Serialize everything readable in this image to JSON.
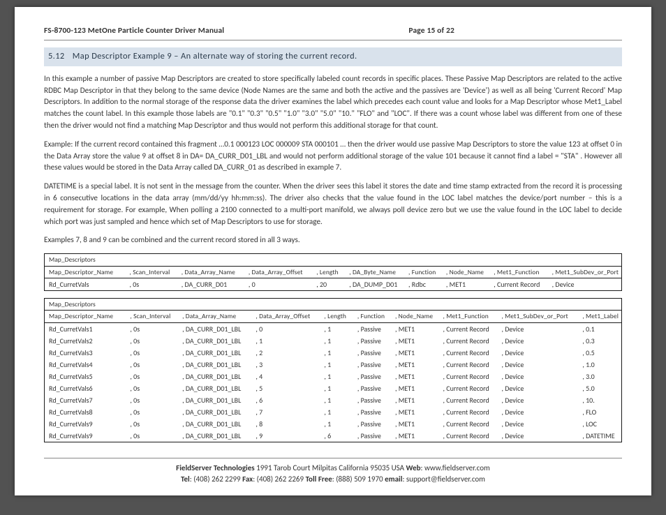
{
  "header": {
    "title": "FS-8700-123 MetOne Particle Counter Driver Manual",
    "page": "Page 15 of 22"
  },
  "section": {
    "number": "5.12",
    "title": "Map Descriptor Example 9 – An alternate way of storing the current record."
  },
  "paras": {
    "p1": "In this example a number of passive Map Descriptors are created to store specifically labeled count records in specific places.  These Passive Map Descriptors are related to the active RDBC Map Descriptor in that they belong to the same device (Node Names are the same and both the active and the passives are 'Device') as well as all being 'Current Record' Map Descriptors.  In addition to the normal storage of the response data the driver examines the label which precedes each count value and looks for a Map Descriptor whose Met1_Label matches the count label.  In this example those labels are \"0.1\"  \"0.3\"  \"0.5\" \"1.0\"  \"3.0\"  \"5.0\"  \"10.\"  \"FLO\" and \"LOC\". If there was a count whose label was different from one of these then the driver would not find a matching Map Descriptor and thus would not perform this additional storage for that count.",
    "p2": "Example: If the current record contained this fragment …0.1 000123  LOC 000009 STA 000101 … then the driver would use passive Map Descriptors to store the value 123 at offset 0 in the Data Array store the value 9 at offset 8 in DA= DA_CURR_D01_LBL and would not perform additional storage of the value 101 because it cannot find a label = \"STA\" . However all these values would be stored in the Data Array called DA_CURR_01 as described in example 7.",
    "p3": "DATETIME is a special label.  It is not sent in the message from the counter.  When the driver sees this label it stores the date and time stamp extracted from the record it is processing in 6 consecutive locations in the data array (mm/dd/yy hh:mm:ss). The driver also checks that the value found in the LOC label matches the device/port number – this is a requirement for storage.  For example, When polling a 2100 connected to a multi-port manifold, we always poll device zero but we use the value found in the LOC label to decide which port was just sampled and hence which set of Map Descriptors to use for storage.",
    "p4": "Examples 7, 8 and 9 can be combined and the current record stored in all 3 ways."
  },
  "table1": {
    "title": "Map_Descriptors",
    "headers": [
      "Map_Descriptor_Name",
      ", Scan_Interval",
      ", Data_Array_Name",
      ", Data_Array_Offset",
      ", Length",
      ", DA_Byte_Name",
      ", Function",
      ", Node_Name",
      ", Met1_Function",
      ", Met1_SubDev_or_Port"
    ],
    "row": [
      "Rd_CurretVals",
      ", 0s",
      ", DA_CURR_D01",
      ", 0",
      ", 20",
      ", DA_DUMP_D01",
      ", Rdbc",
      ", MET1",
      ", Current Record",
      ", Device"
    ]
  },
  "table2": {
    "title": "Map_Descriptors",
    "headers": [
      "Map_Descriptor_Name",
      ", Scan_Interval",
      ", Data_Array_Name",
      ", Data_Array_Offset",
      ", Length",
      ", Function",
      ", Node_Name",
      ", Met1_Function",
      ", Met1_SubDev_or_Port",
      ", Met1_Label"
    ],
    "rows": [
      [
        "Rd_CurretVals1",
        ", 0s",
        ", DA_CURR_D01_LBL",
        ", 0",
        ", 1",
        ", Passive",
        ", MET1",
        ", Current Record",
        ", Device",
        ", 0.1"
      ],
      [
        "Rd_CurretVals2",
        ", 0s",
        ", DA_CURR_D01_LBL",
        ", 1",
        ", 1",
        ", Passive",
        ", MET1",
        ", Current Record",
        ", Device",
        ", 0.3"
      ],
      [
        "Rd_CurretVals3",
        ", 0s",
        ", DA_CURR_D01_LBL",
        ", 2",
        ", 1",
        ", Passive",
        ", MET1",
        ", Current Record",
        ", Device",
        ", 0.5"
      ],
      [
        "Rd_CurretVals4",
        ", 0s",
        ", DA_CURR_D01_LBL",
        ", 3",
        ", 1",
        ", Passive",
        ", MET1",
        ", Current Record",
        ", Device",
        ", 1.0"
      ],
      [
        "Rd_CurretVals5",
        ", 0s",
        ", DA_CURR_D01_LBL",
        ", 4",
        ", 1",
        ", Passive",
        ", MET1",
        ", Current Record",
        ", Device",
        ", 3.0"
      ],
      [
        "Rd_CurretVals6",
        ", 0s",
        ", DA_CURR_D01_LBL",
        ", 5",
        ", 1",
        ", Passive",
        ", MET1",
        ", Current Record",
        ", Device",
        ", 5.0"
      ],
      [
        "Rd_CurretVals7",
        ", 0s",
        ", DA_CURR_D01_LBL",
        ", 6",
        ", 1",
        ", Passive",
        ", MET1",
        ", Current Record",
        ", Device",
        ", 10."
      ],
      [
        "Rd_CurretVals8",
        ", 0s",
        ", DA_CURR_D01_LBL",
        ", 7",
        ", 1",
        ", Passive",
        ", MET1",
        ", Current Record",
        ", Device",
        ", FLO"
      ],
      [
        "Rd_CurretVals9",
        ", 0s",
        ", DA_CURR_D01_LBL",
        ", 8",
        ", 1",
        ", Passive",
        ", MET1",
        ", Current Record",
        ", Device",
        ", LOC"
      ],
      [
        "Rd_CurretVals9",
        ", 0s",
        ", DA_CURR_D01_LBL",
        ", 9",
        ", 6",
        ", Passive",
        ", MET1",
        ", Current Record",
        ", Device",
        ", DATETIME"
      ]
    ]
  },
  "footer": {
    "line1_bold1": "FieldServer Technologies",
    "line1_rest": " 1991 Tarob Court Milpitas California 95035 USA   ",
    "line1_bold2": "Web",
    "line1_rest2": ": www.fieldserver.com",
    "tel_label": "Tel",
    "tel": ": (408) 262 2299   ",
    "fax_label": "Fax",
    "fax": ": (408) 262 2269   ",
    "tollfree_label": "Toll Free",
    "tollfree": ": (888) 509 1970   ",
    "email_label": "email",
    "email": ": support@fieldserver.com"
  }
}
